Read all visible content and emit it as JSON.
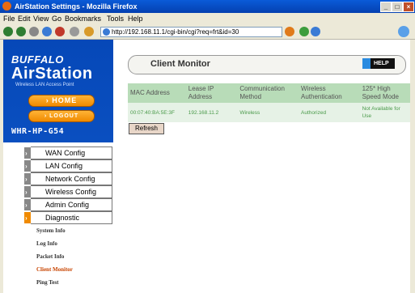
{
  "window": {
    "title": "AirStation Settings - Mozilla Firefox"
  },
  "window_controls": [
    "_",
    "□",
    "×"
  ],
  "menubar": {
    "items": [
      "File",
      "Edit",
      "View",
      "Go",
      "Bookmarks",
      "Tools",
      "Help"
    ]
  },
  "address_bar": {
    "url": "http://192.168.11.1/cgi-bin/cgi?req=frt&id=30"
  },
  "sidebar": {
    "brand": "BUFFALO",
    "product": "AirStation",
    "tagline": "Wireless LAN Access Point",
    "home_label": "HOME",
    "logout_label": "LOGOUT",
    "model": "WHR-HP-G54",
    "menu": [
      {
        "label": "WAN Config"
      },
      {
        "label": "LAN Config"
      },
      {
        "label": "Network Config"
      },
      {
        "label": "Wireless Config"
      },
      {
        "label": "Admin Config"
      },
      {
        "label": "Diagnostic"
      }
    ],
    "sublinks": [
      {
        "label": "System Info"
      },
      {
        "label": "Log Info"
      },
      {
        "label": "Packet Info"
      },
      {
        "label": "Client Monitor"
      },
      {
        "label": "Ping Test"
      }
    ]
  },
  "page": {
    "title": "Client Monitor",
    "help_label": "HELP"
  },
  "table": {
    "headers": [
      "MAC Address",
      "Lease IP Address",
      "Communication Method",
      "Wireless Authentication",
      "125* High Speed Mode"
    ],
    "rows": [
      [
        "00:07:40:BA:5E:3F",
        "192.168.11.2",
        "Wireless",
        "Authorized",
        "Not Available for Use"
      ]
    ]
  },
  "refresh_label": "Refresh",
  "colors": {
    "nav_blue": "#0a4fc0",
    "button_orange": "#f08a00",
    "table_header": "#b8dcb8",
    "table_row": "#e6f2e6"
  }
}
